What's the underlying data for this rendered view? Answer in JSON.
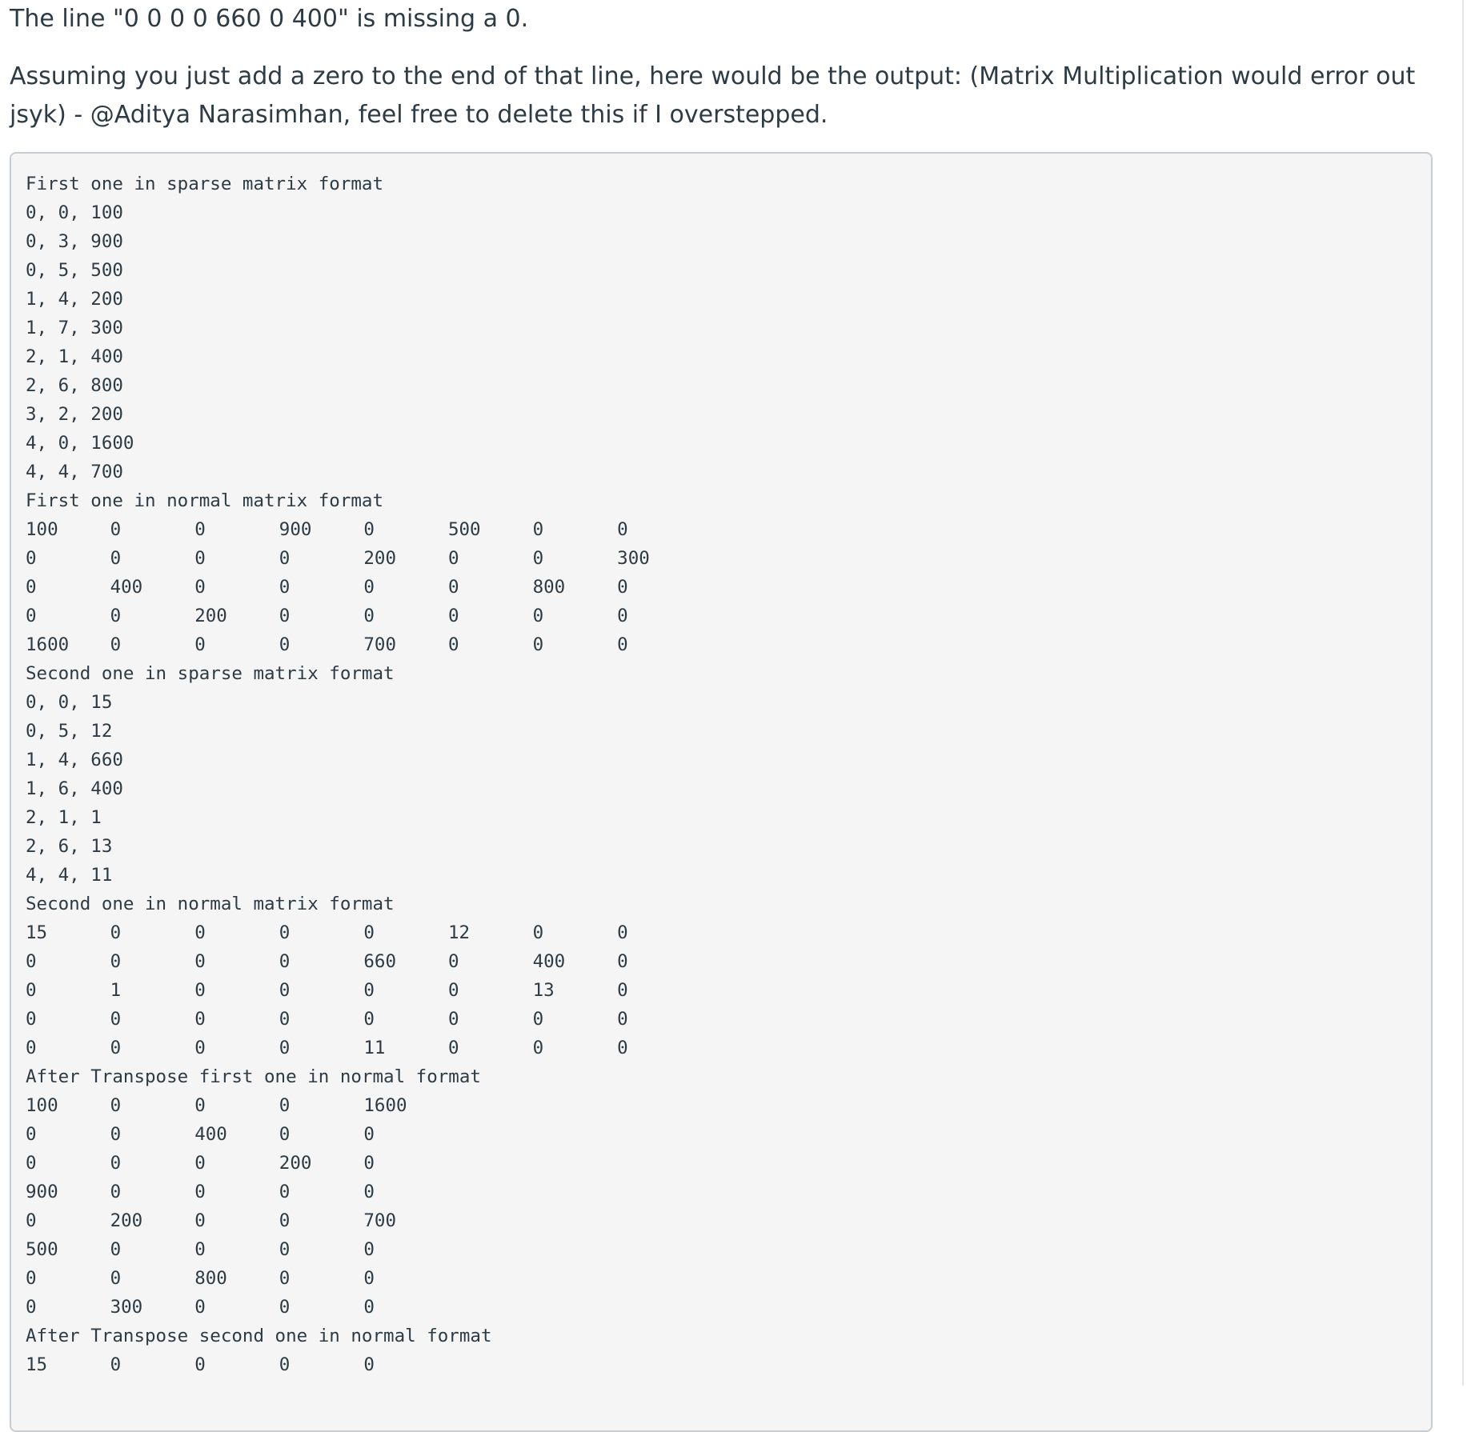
{
  "post": {
    "paragraph_1": "The line \"0 0 0 0 660 0 400\" is missing a 0.",
    "paragraph_2": "Assuming you just add a zero to the end of that line, here would be the output: (Matrix Multiplication would error out jsyk) - @Aditya Narasimhan, feel free to delete this if I overstepped."
  },
  "code": {
    "sections": [
      {
        "heading": "First one in sparse matrix format",
        "lines": [
          "0, 0, 100",
          "0, 3, 900",
          "0, 5, 500",
          "1, 4, 200",
          "1, 7, 300",
          "2, 1, 400",
          "2, 6, 800",
          "3, 2, 200",
          "4, 0, 1600",
          "4, 4, 700"
        ]
      },
      {
        "heading": "First one in normal matrix format",
        "rows": [
          [
            "100",
            "0",
            "0",
            "900",
            "0",
            "500",
            "0",
            "0"
          ],
          [
            "0",
            "0",
            "0",
            "0",
            "200",
            "0",
            "0",
            "300"
          ],
          [
            "0",
            "400",
            "0",
            "0",
            "0",
            "0",
            "800",
            "0"
          ],
          [
            "0",
            "0",
            "200",
            "0",
            "0",
            "0",
            "0",
            "0"
          ],
          [
            "1600",
            "0",
            "0",
            "0",
            "700",
            "0",
            "0",
            "0"
          ]
        ]
      },
      {
        "heading": "Second one in sparse matrix format",
        "lines": [
          "0, 0, 15",
          "0, 5, 12",
          "1, 4, 660",
          "1, 6, 400",
          "2, 1, 1",
          "2, 6, 13",
          "4, 4, 11"
        ]
      },
      {
        "heading": "Second one in normal matrix format",
        "rows": [
          [
            "15",
            "0",
            "0",
            "0",
            "0",
            "12",
            "0",
            "0"
          ],
          [
            "0",
            "0",
            "0",
            "0",
            "660",
            "0",
            "400",
            "0"
          ],
          [
            "0",
            "1",
            "0",
            "0",
            "0",
            "0",
            "13",
            "0"
          ],
          [
            "0",
            "0",
            "0",
            "0",
            "0",
            "0",
            "0",
            "0"
          ],
          [
            "0",
            "0",
            "0",
            "0",
            "11",
            "0",
            "0",
            "0"
          ]
        ]
      },
      {
        "heading": "After Transpose first one in normal format",
        "rows": [
          [
            "100",
            "0",
            "0",
            "0",
            "1600"
          ],
          [
            "0",
            "0",
            "400",
            "0",
            "0"
          ],
          [
            "0",
            "0",
            "0",
            "200",
            "0"
          ],
          [
            "900",
            "0",
            "0",
            "0",
            "0"
          ],
          [
            "0",
            "200",
            "0",
            "0",
            "700"
          ],
          [
            "500",
            "0",
            "0",
            "0",
            "0"
          ],
          [
            "0",
            "0",
            "800",
            "0",
            "0"
          ],
          [
            "0",
            "300",
            "0",
            "0",
            "0"
          ]
        ]
      },
      {
        "heading": "After Transpose second one in normal format",
        "rows": [
          [
            "15",
            "0",
            "0",
            "0",
            "0"
          ]
        ]
      }
    ]
  }
}
